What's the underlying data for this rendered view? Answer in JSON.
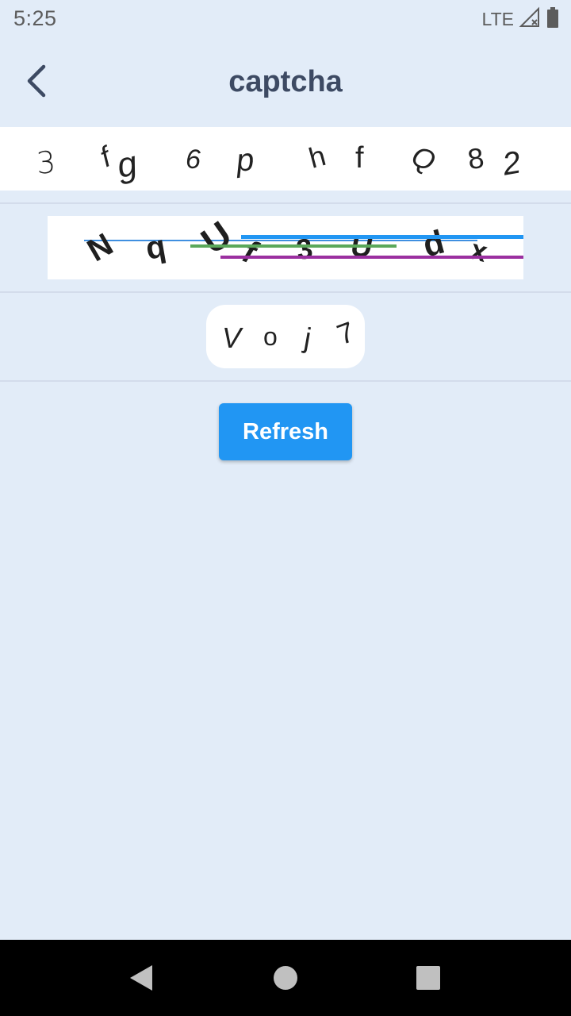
{
  "status_bar": {
    "time": "5:25",
    "network": "LTE",
    "icons": [
      "signal-icon",
      "battery-icon"
    ]
  },
  "app_bar": {
    "title": "captcha",
    "back_icon": "back-arrow-icon"
  },
  "captcha_rows": [
    {
      "style": "thin-italic",
      "characters": [
        "3",
        "f",
        "g",
        "6",
        "p",
        "h",
        "f",
        "Q",
        "8",
        "2"
      ]
    },
    {
      "style": "bold-with-noise-lines",
      "characters": [
        "N",
        "q",
        "U",
        "f",
        "3",
        "U",
        "d",
        "x"
      ],
      "noise_line_colors": [
        "#3f8fe0",
        "#5aa85a",
        "#9b2fa0",
        "#2196f3"
      ]
    },
    {
      "style": "rounded-pill",
      "characters": [
        "V",
        "o",
        "j",
        "7"
      ]
    }
  ],
  "refresh_button": {
    "label": "Refresh"
  },
  "colors": {
    "background": "#e2ecf8",
    "accent": "#2196f3",
    "title": "#3d4a63"
  },
  "nav_bar": {
    "icons": [
      "nav-back-icon",
      "nav-home-icon",
      "nav-recents-icon"
    ]
  }
}
